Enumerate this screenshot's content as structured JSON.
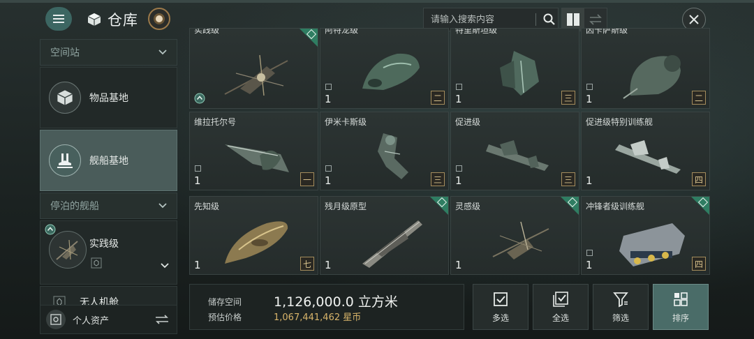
{
  "header": {
    "title": "仓库",
    "title_icon": "cube-icon",
    "search_placeholder": "请输入搜索内容"
  },
  "sidebar": {
    "groups": [
      {
        "label": "空间站"
      },
      {
        "label": "停泊的舰船"
      }
    ],
    "items": [
      {
        "label": "物品基地",
        "icon": "cube-icon"
      },
      {
        "label": "舰船基地",
        "icon": "ship-hangar-icon",
        "active": true
      }
    ],
    "docked_ship": {
      "name": "实践级"
    },
    "drone_bay": {
      "label": "无人机舱"
    },
    "personal_assets": {
      "label": "个人资产"
    }
  },
  "grid": {
    "items": [
      {
        "name": "实践级",
        "qty": "",
        "tier": "",
        "corner": true,
        "upgrade": true
      },
      {
        "name": "阿特龙级",
        "qty": "1",
        "tier": "二",
        "locked": true
      },
      {
        "name": "特里斯坦级",
        "qty": "1",
        "tier": "三",
        "locked": true
      },
      {
        "name": "因卡萨斯级",
        "qty": "1",
        "tier": "二",
        "locked": true
      },
      {
        "name": "维拉托尔号",
        "qty": "1",
        "tier": "一",
        "locked": true
      },
      {
        "name": "伊米卡斯级",
        "qty": "1",
        "tier": "三",
        "locked": true
      },
      {
        "name": "促进级",
        "qty": "1",
        "tier": "三",
        "locked": true
      },
      {
        "name": "促进级特别训练舰",
        "qty": "1",
        "tier": "四",
        "locked": false
      },
      {
        "name": "先知级",
        "qty": "1",
        "tier": "七",
        "locked": false
      },
      {
        "name": "残月级原型",
        "qty": "1",
        "tier": "",
        "corner": true
      },
      {
        "name": "灵感级",
        "qty": "1",
        "tier": "",
        "corner": true
      },
      {
        "name": "冲锋者级训练舰",
        "qty": "1",
        "tier": "四",
        "corner": true,
        "locked": true
      }
    ]
  },
  "storage": {
    "space_label": "储存空间",
    "space_value": "1,126,000.0 立方米",
    "price_label": "预估价格",
    "price_value": "1,067,441,462 星币"
  },
  "actions": [
    {
      "label": "多选",
      "icon": "multi-select-icon"
    },
    {
      "label": "全选",
      "icon": "select-all-icon"
    },
    {
      "label": "筛选",
      "icon": "filter-icon"
    },
    {
      "label": "排序",
      "icon": "sort-icon",
      "active": true
    }
  ],
  "colors": {
    "accent": "#4a6c68",
    "corner_green": "#2f7d62",
    "tier_gold": "#d6c08c",
    "price_gold": "#d8b46a"
  }
}
